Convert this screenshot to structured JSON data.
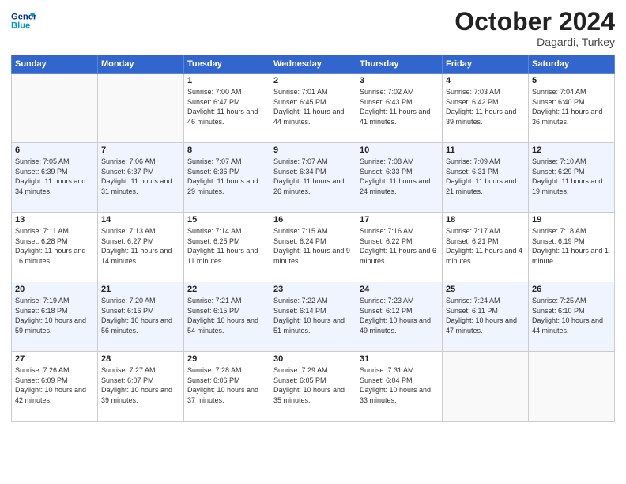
{
  "header": {
    "logo_line1": "General",
    "logo_line2": "Blue",
    "month": "October 2024",
    "location": "Dagardi, Turkey"
  },
  "weekdays": [
    "Sunday",
    "Monday",
    "Tuesday",
    "Wednesday",
    "Thursday",
    "Friday",
    "Saturday"
  ],
  "weeks": [
    [
      {
        "day": "",
        "sunrise": "",
        "sunset": "",
        "daylight": ""
      },
      {
        "day": "",
        "sunrise": "",
        "sunset": "",
        "daylight": ""
      },
      {
        "day": "1",
        "sunrise": "Sunrise: 7:00 AM",
        "sunset": "Sunset: 6:47 PM",
        "daylight": "Daylight: 11 hours and 46 minutes."
      },
      {
        "day": "2",
        "sunrise": "Sunrise: 7:01 AM",
        "sunset": "Sunset: 6:45 PM",
        "daylight": "Daylight: 11 hours and 44 minutes."
      },
      {
        "day": "3",
        "sunrise": "Sunrise: 7:02 AM",
        "sunset": "Sunset: 6:43 PM",
        "daylight": "Daylight: 11 hours and 41 minutes."
      },
      {
        "day": "4",
        "sunrise": "Sunrise: 7:03 AM",
        "sunset": "Sunset: 6:42 PM",
        "daylight": "Daylight: 11 hours and 39 minutes."
      },
      {
        "day": "5",
        "sunrise": "Sunrise: 7:04 AM",
        "sunset": "Sunset: 6:40 PM",
        "daylight": "Daylight: 11 hours and 36 minutes."
      }
    ],
    [
      {
        "day": "6",
        "sunrise": "Sunrise: 7:05 AM",
        "sunset": "Sunset: 6:39 PM",
        "daylight": "Daylight: 11 hours and 34 minutes."
      },
      {
        "day": "7",
        "sunrise": "Sunrise: 7:06 AM",
        "sunset": "Sunset: 6:37 PM",
        "daylight": "Daylight: 11 hours and 31 minutes."
      },
      {
        "day": "8",
        "sunrise": "Sunrise: 7:07 AM",
        "sunset": "Sunset: 6:36 PM",
        "daylight": "Daylight: 11 hours and 29 minutes."
      },
      {
        "day": "9",
        "sunrise": "Sunrise: 7:07 AM",
        "sunset": "Sunset: 6:34 PM",
        "daylight": "Daylight: 11 hours and 26 minutes."
      },
      {
        "day": "10",
        "sunrise": "Sunrise: 7:08 AM",
        "sunset": "Sunset: 6:33 PM",
        "daylight": "Daylight: 11 hours and 24 minutes."
      },
      {
        "day": "11",
        "sunrise": "Sunrise: 7:09 AM",
        "sunset": "Sunset: 6:31 PM",
        "daylight": "Daylight: 11 hours and 21 minutes."
      },
      {
        "day": "12",
        "sunrise": "Sunrise: 7:10 AM",
        "sunset": "Sunset: 6:29 PM",
        "daylight": "Daylight: 11 hours and 19 minutes."
      }
    ],
    [
      {
        "day": "13",
        "sunrise": "Sunrise: 7:11 AM",
        "sunset": "Sunset: 6:28 PM",
        "daylight": "Daylight: 11 hours and 16 minutes."
      },
      {
        "day": "14",
        "sunrise": "Sunrise: 7:13 AM",
        "sunset": "Sunset: 6:27 PM",
        "daylight": "Daylight: 11 hours and 14 minutes."
      },
      {
        "day": "15",
        "sunrise": "Sunrise: 7:14 AM",
        "sunset": "Sunset: 6:25 PM",
        "daylight": "Daylight: 11 hours and 11 minutes."
      },
      {
        "day": "16",
        "sunrise": "Sunrise: 7:15 AM",
        "sunset": "Sunset: 6:24 PM",
        "daylight": "Daylight: 11 hours and 9 minutes."
      },
      {
        "day": "17",
        "sunrise": "Sunrise: 7:16 AM",
        "sunset": "Sunset: 6:22 PM",
        "daylight": "Daylight: 11 hours and 6 minutes."
      },
      {
        "day": "18",
        "sunrise": "Sunrise: 7:17 AM",
        "sunset": "Sunset: 6:21 PM",
        "daylight": "Daylight: 11 hours and 4 minutes."
      },
      {
        "day": "19",
        "sunrise": "Sunrise: 7:18 AM",
        "sunset": "Sunset: 6:19 PM",
        "daylight": "Daylight: 11 hours and 1 minute."
      }
    ],
    [
      {
        "day": "20",
        "sunrise": "Sunrise: 7:19 AM",
        "sunset": "Sunset: 6:18 PM",
        "daylight": "Daylight: 10 hours and 59 minutes."
      },
      {
        "day": "21",
        "sunrise": "Sunrise: 7:20 AM",
        "sunset": "Sunset: 6:16 PM",
        "daylight": "Daylight: 10 hours and 56 minutes."
      },
      {
        "day": "22",
        "sunrise": "Sunrise: 7:21 AM",
        "sunset": "Sunset: 6:15 PM",
        "daylight": "Daylight: 10 hours and 54 minutes."
      },
      {
        "day": "23",
        "sunrise": "Sunrise: 7:22 AM",
        "sunset": "Sunset: 6:14 PM",
        "daylight": "Daylight: 10 hours and 51 minutes."
      },
      {
        "day": "24",
        "sunrise": "Sunrise: 7:23 AM",
        "sunset": "Sunset: 6:12 PM",
        "daylight": "Daylight: 10 hours and 49 minutes."
      },
      {
        "day": "25",
        "sunrise": "Sunrise: 7:24 AM",
        "sunset": "Sunset: 6:11 PM",
        "daylight": "Daylight: 10 hours and 47 minutes."
      },
      {
        "day": "26",
        "sunrise": "Sunrise: 7:25 AM",
        "sunset": "Sunset: 6:10 PM",
        "daylight": "Daylight: 10 hours and 44 minutes."
      }
    ],
    [
      {
        "day": "27",
        "sunrise": "Sunrise: 7:26 AM",
        "sunset": "Sunset: 6:09 PM",
        "daylight": "Daylight: 10 hours and 42 minutes."
      },
      {
        "day": "28",
        "sunrise": "Sunrise: 7:27 AM",
        "sunset": "Sunset: 6:07 PM",
        "daylight": "Daylight: 10 hours and 39 minutes."
      },
      {
        "day": "29",
        "sunrise": "Sunrise: 7:28 AM",
        "sunset": "Sunset: 6:06 PM",
        "daylight": "Daylight: 10 hours and 37 minutes."
      },
      {
        "day": "30",
        "sunrise": "Sunrise: 7:29 AM",
        "sunset": "Sunset: 6:05 PM",
        "daylight": "Daylight: 10 hours and 35 minutes."
      },
      {
        "day": "31",
        "sunrise": "Sunrise: 7:31 AM",
        "sunset": "Sunset: 6:04 PM",
        "daylight": "Daylight: 10 hours and 33 minutes."
      },
      {
        "day": "",
        "sunrise": "",
        "sunset": "",
        "daylight": ""
      },
      {
        "day": "",
        "sunrise": "",
        "sunset": "",
        "daylight": ""
      }
    ]
  ]
}
